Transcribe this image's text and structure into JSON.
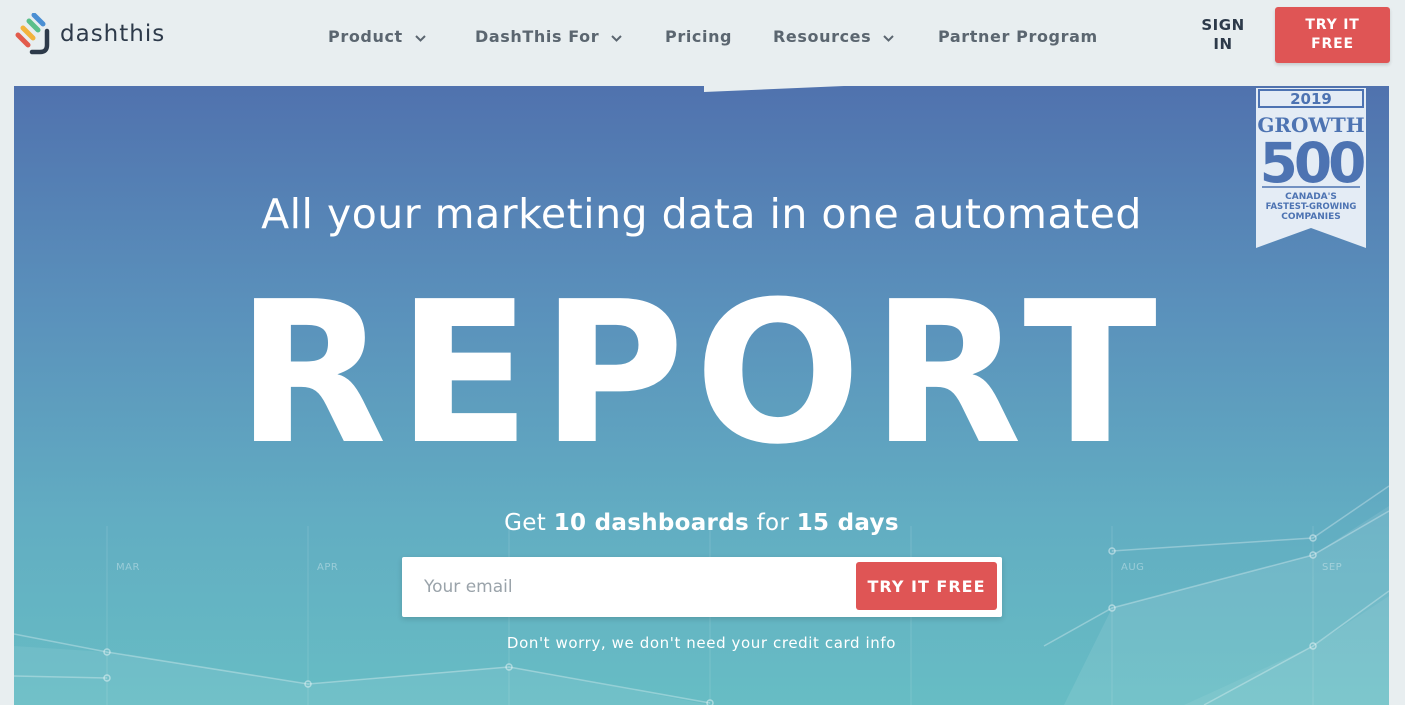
{
  "brand": {
    "name": "dashthis",
    "colors": {
      "accent": "#df5555",
      "hero_top": "#5072ae",
      "hero_bottom": "#67bdc4",
      "text_dark": "#2d3a4a"
    }
  },
  "nav": {
    "items": [
      {
        "label": "Product",
        "has_dropdown": true
      },
      {
        "label": "DashThis For",
        "has_dropdown": true
      },
      {
        "label": "Pricing",
        "has_dropdown": false
      },
      {
        "label": "Resources",
        "has_dropdown": true
      },
      {
        "label": "Partner Program",
        "has_dropdown": false
      }
    ],
    "sign_in": {
      "line1": "SIGN",
      "line2": "IN"
    },
    "cta": {
      "line1": "TRY IT",
      "line2": "FREE"
    }
  },
  "hero": {
    "headline": "All your marketing data in one automated",
    "big_word": "REPORT",
    "offer": {
      "prefix": "Get",
      "count": "10 dashboards",
      "middle": "for",
      "duration": "15 days"
    },
    "email_placeholder": "Your email",
    "cta_label": "TRY IT FREE",
    "note": "Don't worry, we don't need your credit card info",
    "months": [
      "MAR",
      "APR",
      "AUG",
      "SEP"
    ]
  },
  "badge": {
    "year": "2019",
    "title": "GROWTH",
    "number": "500",
    "line1": "CANADA'S",
    "line2": "FASTEST-GROWING",
    "line3": "COMPANIES"
  }
}
